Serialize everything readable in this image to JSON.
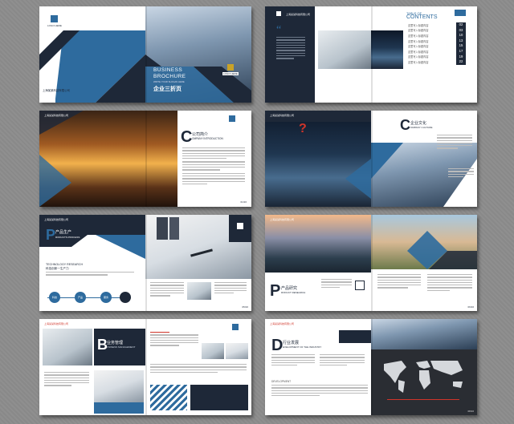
{
  "cover": {
    "logo_left": "LOGO HERE",
    "company_left": "上海某某科技有限公司",
    "title_line1": "BUSINESS",
    "title_line2": "BROCHURE",
    "subtitle_en": "WRITE YOUR SLOGAN HERE",
    "title_cn": "企业三折页",
    "logo_right": "LOGO HERE"
  },
  "toc": {
    "heading_small": "TABLE OF",
    "heading_big": "CONTENTS",
    "quote_mark": "“",
    "rows": [
      {
        "label": "这里写入标题内容",
        "num": "02"
      },
      {
        "label": "这里写入标题内容",
        "num": "03"
      },
      {
        "label": "这里写入标题内容",
        "num": "10"
      },
      {
        "label": "这里写入标题内容",
        "num": "13"
      },
      {
        "label": "这里写入标题内容",
        "num": "15"
      },
      {
        "label": "这里写入标题内容",
        "num": "17"
      },
      {
        "label": "这里写入标题内容",
        "num": "19"
      },
      {
        "label": "这里写入标题内容",
        "num": "22"
      }
    ]
  },
  "intro": {
    "letter": "C",
    "title_cn": "公司简介",
    "title_en": "OMPANY INTRODUCTION",
    "page": "01/16"
  },
  "culture": {
    "letter": "C",
    "title_cn": "企业文化",
    "title_en": "OMPANY CULTURE",
    "question": "?"
  },
  "products": {
    "letter": "P",
    "title_cn": "产品生产",
    "title_en": "RODUCTS PROCESS",
    "subheading": "TECHNOLOGY RESEARCH",
    "subheading_cn": "科技创新一生产力",
    "steps": [
      "科技",
      "产品",
      "服务"
    ],
    "page": "05/16"
  },
  "research": {
    "letter": "P",
    "title_cn": "产品研究",
    "title_en": "RODUCT RESEARCH",
    "page": "06/16"
  },
  "management": {
    "letter": "B",
    "title_cn": "业务管理",
    "title_en": "USINESS MANAGEMENT"
  },
  "industry": {
    "letter": "D",
    "title_cn": "行业发展",
    "title_en": "EVELOPMENT OF THE INDUSTRY",
    "development": "DEVELOPMENT",
    "page": "08/16"
  },
  "colors": {
    "navy": "#1e2838",
    "blue": "#2e6b9e",
    "accent_red": "#d0352a"
  }
}
